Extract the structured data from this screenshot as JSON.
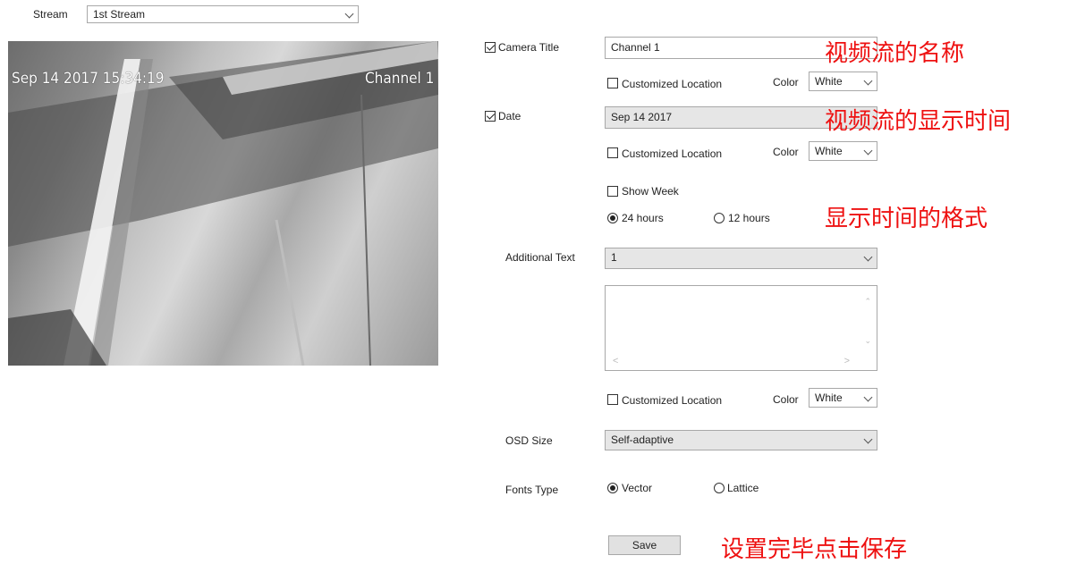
{
  "stream": {
    "label": "Stream",
    "value": "1st Stream"
  },
  "video": {
    "date_overlay": "Sep 14 2017 15:34:19",
    "title_overlay": "Channel 1"
  },
  "camera_title": {
    "label": "Camera Title",
    "checked": true,
    "value": "Channel 1",
    "customized_location_label": "Customized Location",
    "color_label": "Color",
    "color_value": "White"
  },
  "date": {
    "label": "Date",
    "checked": true,
    "value": "Sep 14 2017",
    "customized_location_label": "Customized Location",
    "color_label": "Color",
    "color_value": "White",
    "show_week_label": "Show Week",
    "hours24_label": "24 hours",
    "hours12_label": "12 hours"
  },
  "additional_text": {
    "label": "Additional Text",
    "value": "1",
    "textarea_value": "",
    "customized_location_label": "Customized Location",
    "color_label": "Color",
    "color_value": "White"
  },
  "osd_size": {
    "label": "OSD Size",
    "value": "Self-adaptive"
  },
  "fonts_type": {
    "label": "Fonts Type",
    "vector_label": "Vector",
    "lattice_label": "Lattice"
  },
  "save_label": "Save",
  "annotations": {
    "title_note": "视频流的名称",
    "date_note": "视频流的显示时间",
    "format_note": "显示时间的格式",
    "save_note": "设置完毕点击保存"
  },
  "colors": {
    "annotation": "#ee1111"
  }
}
